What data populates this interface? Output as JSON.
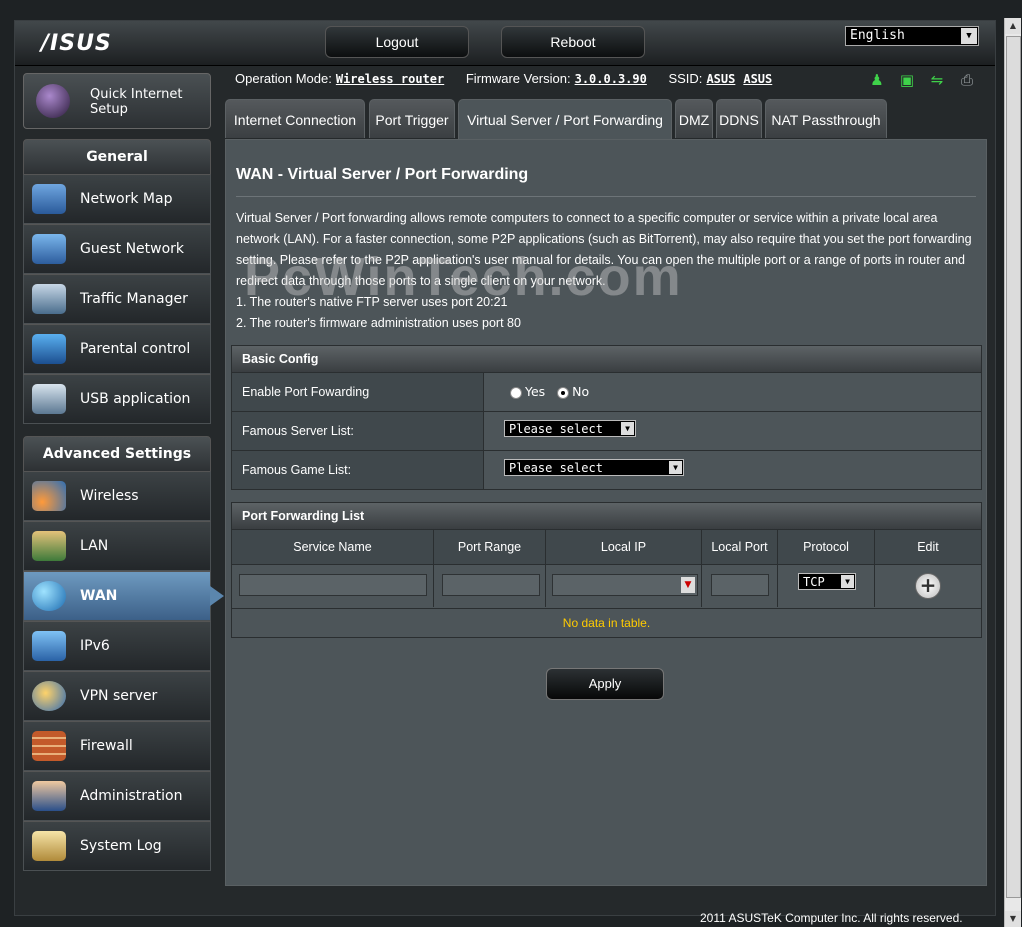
{
  "header": {
    "logo": "/ISUS",
    "logout_label": "Logout",
    "reboot_label": "Reboot",
    "language": "English"
  },
  "status": {
    "op_mode_label": "Operation Mode:",
    "op_mode_value": "Wireless router",
    "firmware_label": "Firmware Version:",
    "firmware_value": "3.0.0.3.90",
    "ssid_label": "SSID:",
    "ssid_1": "ASUS",
    "ssid_2": "ASUS",
    "icons": [
      "user-status-icon",
      "network-status-icon",
      "usb-status-icon",
      "printer-status-icon"
    ]
  },
  "sidebar": {
    "quick_setup": "Quick Internet Setup",
    "general_title": "General",
    "general_items": [
      {
        "label": "Network Map",
        "icon": "network-map-icon"
      },
      {
        "label": "Guest Network",
        "icon": "guest-network-icon"
      },
      {
        "label": "Traffic Manager",
        "icon": "traffic-manager-icon"
      },
      {
        "label": "Parental control",
        "icon": "parental-control-icon"
      },
      {
        "label": "USB application",
        "icon": "usb-application-icon"
      }
    ],
    "advanced_title": "Advanced Settings",
    "advanced_items": [
      {
        "label": "Wireless",
        "icon": "wireless-icon"
      },
      {
        "label": "LAN",
        "icon": "lan-icon"
      },
      {
        "label": "WAN",
        "icon": "wan-icon"
      },
      {
        "label": "IPv6",
        "icon": "ipv6-icon"
      },
      {
        "label": "VPN server",
        "icon": "vpn-server-icon"
      },
      {
        "label": "Firewall",
        "icon": "firewall-icon"
      },
      {
        "label": "Administration",
        "icon": "administration-icon"
      },
      {
        "label": "System Log",
        "icon": "system-log-icon"
      }
    ]
  },
  "tabs": [
    {
      "label": "Internet Connection"
    },
    {
      "label": "Port Trigger"
    },
    {
      "label": "Virtual Server / Port Forwarding"
    },
    {
      "label": "DMZ"
    },
    {
      "label": "DDNS"
    },
    {
      "label": "NAT Passthrough"
    }
  ],
  "main": {
    "title": "WAN - Virtual Server / Port Forwarding",
    "description": "Virtual Server / Port forwarding allows remote computers to connect to a specific computer or service within a private local area network (LAN). For a faster connection, some P2P applications (such as BitTorrent), may also require that you set the port forwarding setting. Please refer to the P2P application's user manual for details. You can open the multiple port or a range of ports in router and redirect data through those ports to a single client on your network.",
    "note_1": "1. The router's native FTP server uses port 20:21",
    "note_2": "2. The router's firmware administration uses port 80",
    "watermark": "PcWinTech.com"
  },
  "basic_config": {
    "title": "Basic Config",
    "enable_label": "Enable Port Fowarding",
    "yes_label": "Yes",
    "no_label": "No",
    "server_list_label": "Famous Server List:",
    "server_list_value": "Please select",
    "game_list_label": "Famous Game List:",
    "game_list_value": "Please select"
  },
  "pf_list": {
    "title": "Port Forwarding List",
    "columns": [
      "Service Name",
      "Port Range",
      "Local IP",
      "Local Port",
      "Protocol",
      "Edit"
    ],
    "protocol_value": "TCP",
    "empty_text": "No data in table."
  },
  "apply_label": "Apply",
  "footer": "2011 ASUSTeK Computer Inc. All rights reserved."
}
